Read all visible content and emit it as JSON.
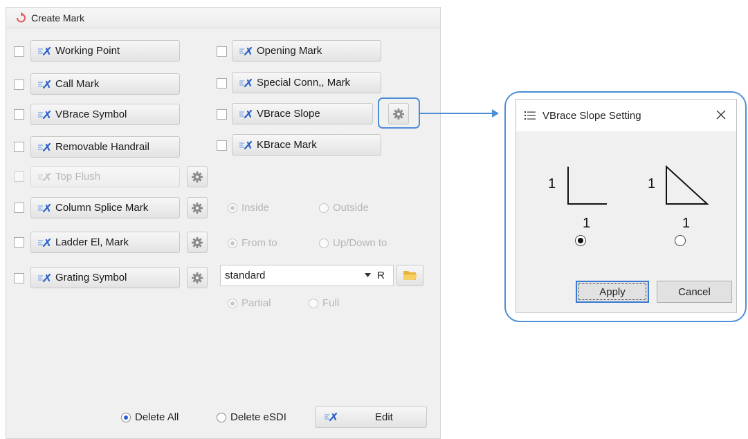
{
  "panel": {
    "title": "Create Mark",
    "left_items": [
      {
        "label": "Working Point",
        "checked": false,
        "enabled": true
      },
      {
        "label": "Call Mark",
        "checked": false,
        "enabled": true
      },
      {
        "label": "VBrace Symbol",
        "checked": false,
        "enabled": true
      },
      {
        "label": "Removable Handrail",
        "checked": false,
        "enabled": true
      },
      {
        "label": "Top Flush",
        "checked": false,
        "enabled": false
      },
      {
        "label": "Column Splice Mark",
        "checked": false,
        "enabled": true
      },
      {
        "label": "Ladder El, Mark",
        "checked": false,
        "enabled": true
      },
      {
        "label": "Grating Symbol",
        "checked": false,
        "enabled": true
      }
    ],
    "right_items": [
      {
        "label": "Opening Mark",
        "checked": false
      },
      {
        "label": "Special Conn,, Mark",
        "checked": false
      },
      {
        "label": "VBrace Slope",
        "checked": false
      },
      {
        "label": "KBrace Mark",
        "checked": false
      }
    ],
    "column_splice_options": {
      "inside": "Inside",
      "outside": "Outside",
      "selected": "Inside"
    },
    "ladder_options": {
      "from_to": "From to",
      "up_down_to": "Up/Down to",
      "selected": "From to"
    },
    "grating": {
      "combo_value": "standard",
      "combo_suffix": "R"
    },
    "grating_options": {
      "partial": "Partial",
      "full": "Full",
      "selected": "Partial"
    },
    "footer": {
      "delete_all": "Delete All",
      "delete_esdi": "Delete eSDI",
      "selected": "Delete All",
      "edit_label": "Edit"
    }
  },
  "dialog": {
    "title": "VBrace Slope Setting",
    "option_a": {
      "vertical": "1",
      "horizontal": "1"
    },
    "option_b": {
      "vertical": "1",
      "horizontal": "1"
    },
    "selected": "option_a",
    "apply_label": "Apply",
    "cancel_label": "Cancel"
  },
  "colors": {
    "highlight": "#4d8ed6",
    "accent": "#2a5bd7"
  }
}
